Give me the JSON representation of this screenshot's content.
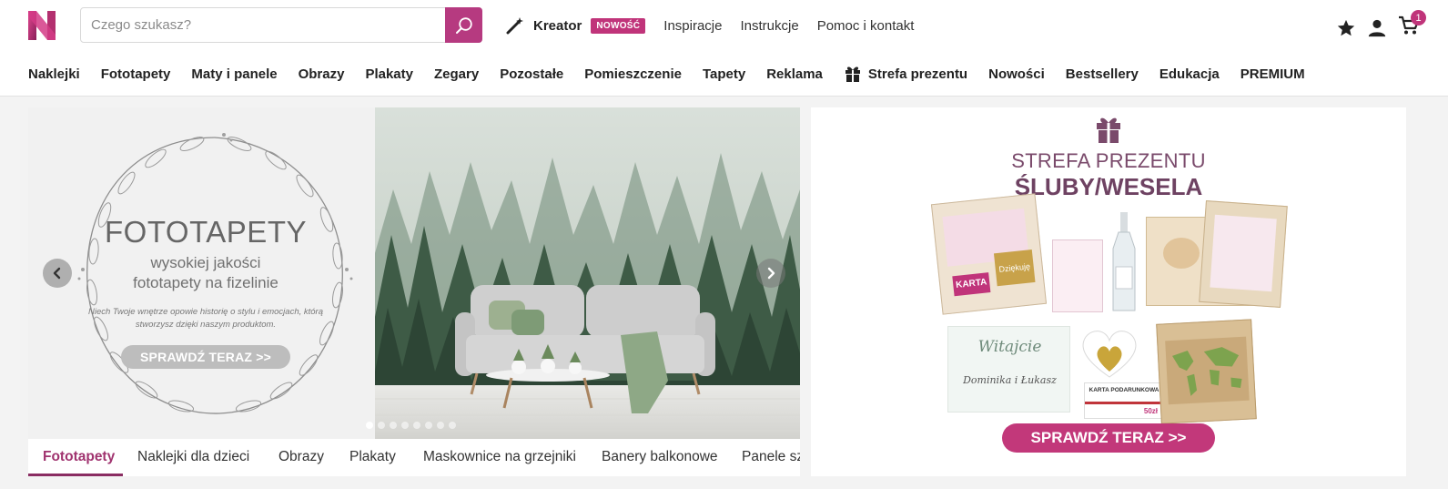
{
  "search": {
    "placeholder": "Czego szukasz?"
  },
  "topnav": {
    "kreator": "Kreator",
    "badge": "NOWOŚĆ",
    "links": [
      "Inspiracje",
      "Instrukcje",
      "Pomoc i kontakt"
    ]
  },
  "cart": {
    "count": "1"
  },
  "mainnav": [
    "Naklejki",
    "Fototapety",
    "Maty i panele",
    "Obrazy",
    "Plakaty",
    "Zegary",
    "Pozostałe",
    "Pomieszczenie",
    "Tapety",
    "Reklama",
    "Strefa prezentu",
    "Nowości",
    "Bestsellery",
    "Edukacja",
    "PREMIUM"
  ],
  "slider": {
    "title": "FOTOTAPETY",
    "subtitle_line1": "wysokiej jakości",
    "subtitle_line2": "fototapety na fizelinie",
    "note": "Niech Twoje wnętrze opowie historię o stylu i emocjach, którą stworzysz dzięki naszym produktom.",
    "cta": "SPRAWDŹ TERAZ >>",
    "dots_total": 8,
    "dots_active": 0
  },
  "tabs": [
    "Fototapety",
    "Naklejki dla dzieci",
    "Obrazy",
    "Plakaty",
    "Maskownice na grzejniki",
    "Banery balkonowe",
    "Panele sz"
  ],
  "promo": {
    "title1": "STREFA PREZENTU",
    "title2": "ŚLUBY/WESELA",
    "cta": "SPRAWDŹ TERAZ >>",
    "product_texts": {
      "karta": "KARTA",
      "dziekuje": "Dziękuję",
      "witajcie": "Witajcie",
      "names": "Dominika i Łukasz",
      "gift_card": "KARTA PODARUNKOWA",
      "amount": "50zł"
    }
  },
  "colors": {
    "brand": "#c0347a",
    "search_button": "#b63a80",
    "promo_cta": "#c2387a",
    "active_tab": "#a0336f"
  }
}
